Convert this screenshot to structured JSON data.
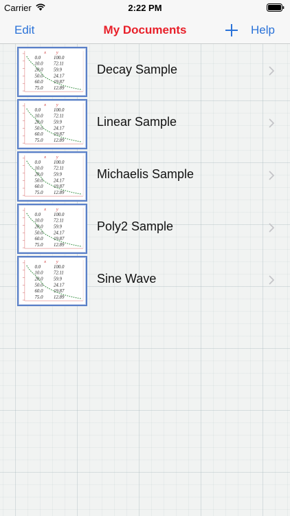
{
  "status_bar": {
    "carrier": "Carrier",
    "time": "2:22 PM"
  },
  "nav": {
    "edit_label": "Edit",
    "title": "My Documents",
    "help_label": "Help"
  },
  "thumbnail_table": {
    "headers": [
      "x",
      "y"
    ],
    "rows": [
      [
        "0.0",
        "100.0"
      ],
      [
        "10.0",
        "72.11"
      ],
      [
        "20.0",
        "59.9"
      ],
      [
        "50.0",
        "24.17"
      ],
      [
        "60.0",
        "19.87"
      ],
      [
        "75.0",
        "12.89"
      ]
    ]
  },
  "documents": [
    {
      "title": "Decay Sample"
    },
    {
      "title": "Linear Sample"
    },
    {
      "title": "Michaelis Sample"
    },
    {
      "title": "Poly2 Sample"
    },
    {
      "title": "Sine Wave"
    }
  ],
  "colors": {
    "accent": "#2a72d8",
    "title": "#e8202a",
    "thumb_border": "#5a80c8"
  }
}
